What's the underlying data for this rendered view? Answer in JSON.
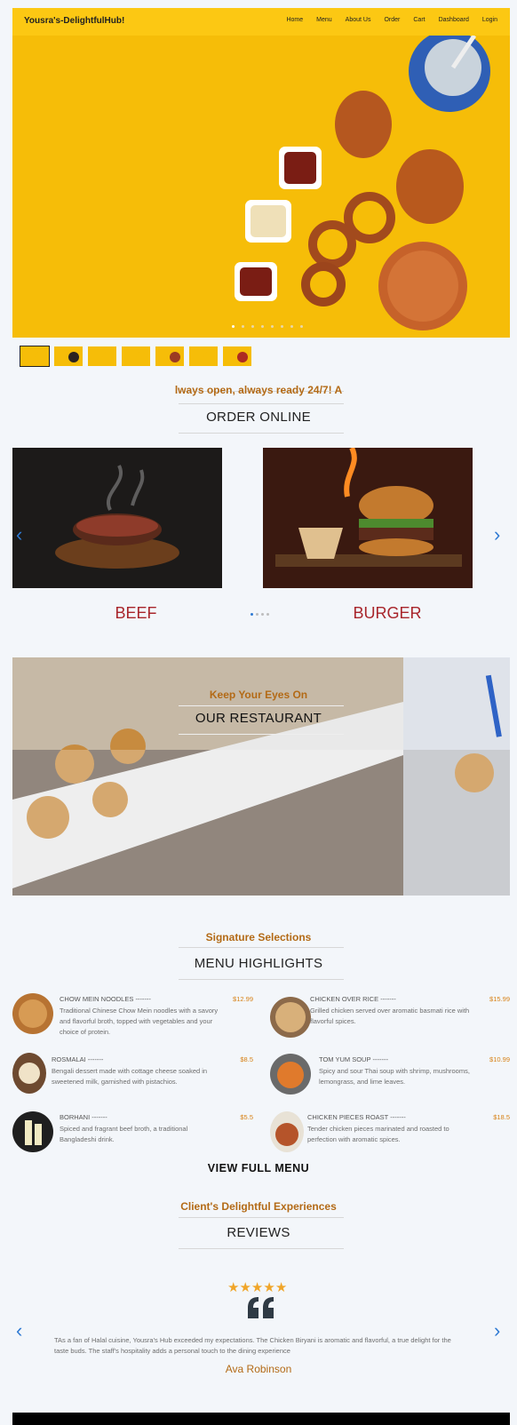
{
  "nav": {
    "brand": "Yousra's-DelightfulHub!",
    "links": [
      "Home",
      "Menu",
      "About Us",
      "Order",
      "Cart",
      "Dashboard",
      "Login"
    ]
  },
  "hero": {
    "slide_count": 8,
    "active_slide": 1,
    "thumb_count": 7,
    "active_thumb": 1
  },
  "order": {
    "marquee": "lways open, always ready 24/7! A",
    "title": "ORDER ONLINE",
    "categories": [
      "BEEF",
      "BURGER"
    ],
    "page_dots": 4,
    "active_dot": 1
  },
  "restaurant": {
    "kicker": "Keep Your Eyes On",
    "title": "OUR RESTAURANT"
  },
  "menu": {
    "kicker": "Signature Selections",
    "title": "MENU HIGHLIGHTS",
    "view_full": "VIEW FULL MENU",
    "items": [
      {
        "name": "CHOW MEIN NOODLES",
        "dash": "-------",
        "price": "$12.99",
        "desc": "Traditional Chinese Chow Mein noodles with a savory and flavorful broth, topped with vegetables and your choice of protein."
      },
      {
        "name": "CHICKEN OVER RICE",
        "dash": "-------",
        "price": "$15.99",
        "desc": "Grilled chicken served over aromatic basmati rice with flavorful spices."
      },
      {
        "name": "ROSMALAI",
        "dash": "-------",
        "price": "$8.5",
        "desc": "Bengali dessert made with cottage cheese soaked in sweetened milk, garnished with pistachios."
      },
      {
        "name": "TOM YUM SOUP",
        "dash": "-------",
        "price": "$10.99",
        "desc": "Spicy and sour Thai soup with shrimp, mushrooms, lemongrass, and lime leaves."
      },
      {
        "name": "BORHANI",
        "dash": "-------",
        "price": "$5.5",
        "desc": "Spiced and fragrant beef broth, a traditional Bangladeshi drink."
      },
      {
        "name": "CHICKEN PIECES ROAST",
        "dash": "-------",
        "price": "$18.5",
        "desc": "Tender chicken pieces marinated and roasted to perfection with aromatic spices."
      }
    ]
  },
  "reviews": {
    "kicker": "Client's Delightful Experiences",
    "title": "REVIEWS",
    "rating": 5,
    "quote": "TAs a fan of Halal cuisine, Yousra's Hub exceeded my expectations. The Chicken Biryani is aromatic and flavorful, a true delight for the taste buds. The staff's hospitality adds a personal touch to the dining experience",
    "author": "Ava Robinson"
  },
  "icons": {
    "quote": "quote-icon",
    "prev": "chevron-left-icon",
    "next": "chevron-right-icon",
    "star": "star-icon"
  },
  "colors": {
    "brand_yellow": "#fcc813",
    "accent_brown": "#b36a16",
    "category_red": "#a8252b",
    "price_orange": "#d78116",
    "arrow_blue": "#2f7ad3"
  }
}
